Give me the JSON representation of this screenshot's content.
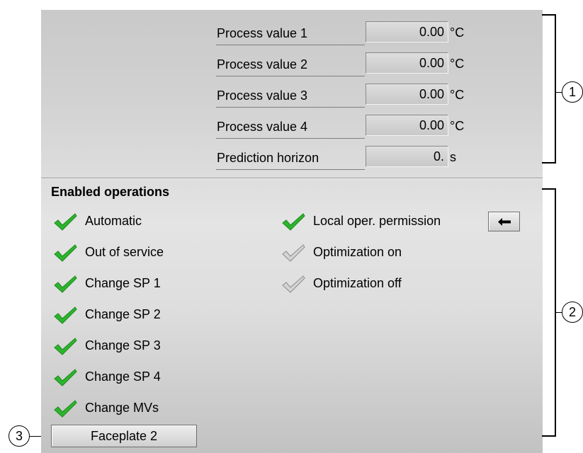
{
  "process_values": [
    {
      "label": "Process value 1",
      "value": "0.00",
      "unit": "°C"
    },
    {
      "label": "Process value 2",
      "value": "0.00",
      "unit": "°C"
    },
    {
      "label": "Process value 3",
      "value": "0.00",
      "unit": "°C"
    },
    {
      "label": "Process value 4",
      "value": "0.00",
      "unit": "°C"
    },
    {
      "label": "Prediction horizon",
      "value": "0.",
      "unit": "s"
    }
  ],
  "enabled_operations": {
    "heading": "Enabled operations",
    "left_column": [
      {
        "label": "Automatic",
        "enabled": true
      },
      {
        "label": "Out of service",
        "enabled": true
      },
      {
        "label": "Change SP 1",
        "enabled": true
      },
      {
        "label": "Change SP 2",
        "enabled": true
      },
      {
        "label": "Change SP 3",
        "enabled": true
      },
      {
        "label": "Change SP 4",
        "enabled": true
      },
      {
        "label": "Change MVs",
        "enabled": true
      }
    ],
    "right_column": [
      {
        "label": "Local oper. permission",
        "enabled": true
      },
      {
        "label": "Optimization on",
        "enabled": false
      },
      {
        "label": "Optimization off",
        "enabled": false
      }
    ],
    "arrow_button_icon": "left-arrow-icon"
  },
  "faceplate_button": {
    "label": "Faceplate 2"
  },
  "callouts": [
    "1",
    "2",
    "3"
  ],
  "colors": {
    "check_enabled": "#2db52d",
    "check_disabled": "#a8a8a8"
  }
}
